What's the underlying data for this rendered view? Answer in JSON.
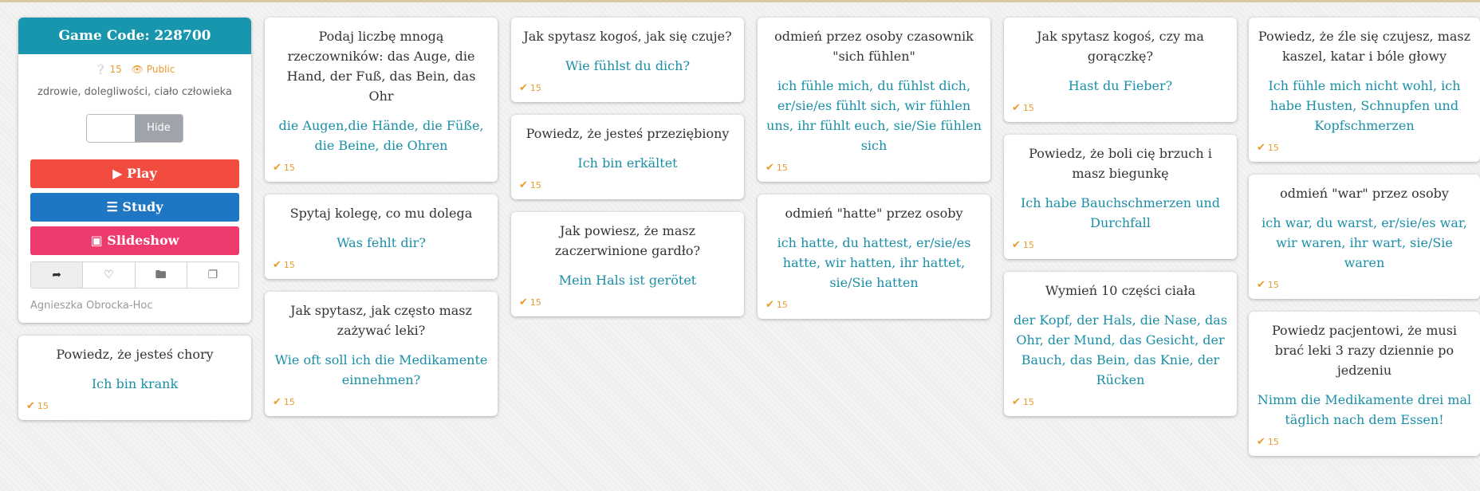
{
  "game": {
    "title": "Game Code: 228700",
    "score": "15",
    "visibility": "Public",
    "topic": "zdrowie, dolegliwości, ciało człowieka",
    "toggle_label": "Hide",
    "play_label": "Play",
    "study_label": "Study",
    "slideshow_label": "Slideshow",
    "author": "Agnieszka Obrocka-Hoc",
    "icons": [
      "share-icon",
      "heart-icon",
      "folder-icon",
      "copy-icon"
    ],
    "colors": {
      "header": "#1896ad",
      "play": "#f24b3f",
      "study": "#1f76c2",
      "slideshow": "#ef3a6d",
      "answer": "#1a8fa8",
      "score": "#e99b2b"
    }
  },
  "columns": [
    [
      {
        "q": "Powiedz, że jesteś chory",
        "a": "Ich bin krank",
        "score": "15"
      }
    ],
    [
      {
        "q": "Podaj liczbę mnogą rzeczowników: das Auge, die Hand, der Fuß, das Bein, das Ohr",
        "a": "die Augen,die Hände, die Füße, die Beine, die Ohren",
        "score": "15"
      },
      {
        "q": "Spytaj kolegę, co mu dolega",
        "a": "Was fehlt dir?",
        "score": "15"
      },
      {
        "q": "Jak spytasz, jak często masz zażywać leki?",
        "a": "Wie oft soll ich die Medikamente einnehmen?",
        "score": "15"
      }
    ],
    [
      {
        "q": "Jak spytasz kogoś, jak się czuje?",
        "a": "Wie fühlst du dich?",
        "score": "15"
      },
      {
        "q": "Powiedz, że jesteś przeziębiony",
        "a": "Ich bin erkältet",
        "score": "15"
      },
      {
        "q": "Jak powiesz, że masz zaczerwinione gardło?",
        "a": "Mein Hals ist gerötet",
        "score": "15"
      }
    ],
    [
      {
        "q": "odmień przez osoby czasownik \"sich fühlen\"",
        "a": "ich fühle mich, du fühlst dich, er/sie/es fühlt sich, wir fühlen uns, ihr fühlt euch, sie/Sie fühlen sich",
        "score": "15"
      },
      {
        "q": "odmień \"hatte\" przez osoby",
        "a": "ich hatte, du hattest, er/sie/es hatte, wir hatten, ihr hattet, sie/Sie hatten",
        "score": "15"
      }
    ],
    [
      {
        "q": "Jak spytasz kogoś, czy ma gorączkę?",
        "a": "Hast du Fieber?",
        "score": "15"
      },
      {
        "q": "Powiedz, że boli cię brzuch i masz biegunkę",
        "a": "Ich habe Bauchschmerzen und Durchfall",
        "score": "15"
      },
      {
        "q": "Wymień 10 części ciała",
        "a": "der Kopf, der Hals, die Nase, das Ohr, der Mund, das Gesicht, der Bauch, das Bein, das Knie, der Rücken",
        "score": "15"
      }
    ],
    [
      {
        "q": "Powiedz, że źle się czujesz, masz kaszel, katar i bóle głowy",
        "a": "Ich fühle mich nicht wohl, ich habe Husten, Schnupfen und Kopfschmerzen",
        "score": "15"
      },
      {
        "q": "odmień \"war\" przez osoby",
        "a": "ich war, du warst, er/sie/es war, wir waren, ihr wart, sie/Sie waren",
        "score": "15"
      },
      {
        "q": "Powiedz pacjentowi, że musi brać leki 3 razy dziennie po jedzeniu",
        "a": "Nimm die Medikamente drei mal täglich nach dem Essen!",
        "score": "15"
      }
    ]
  ]
}
